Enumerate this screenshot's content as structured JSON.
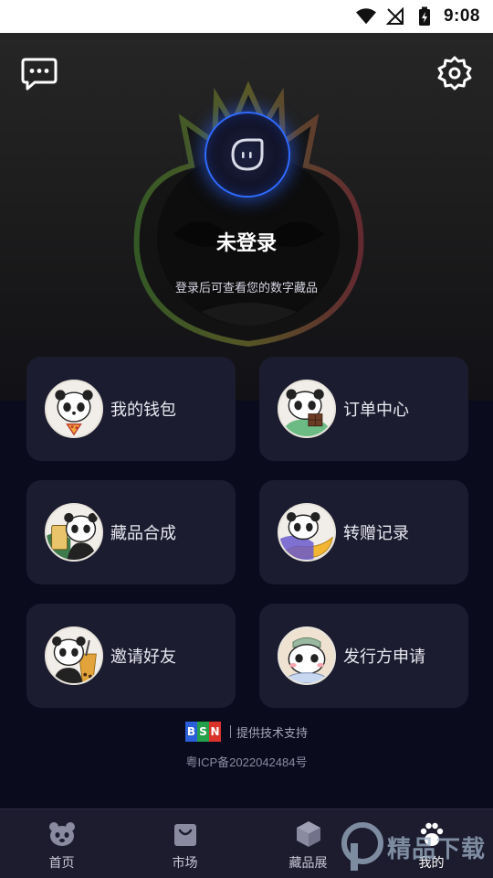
{
  "status_bar": {
    "time": "9:08"
  },
  "header": {
    "title": "未登录",
    "subtitle": "登录后可查看您的数字藏品",
    "icons": [
      "message-icon",
      "settings-icon",
      "avatar-icon"
    ]
  },
  "cards": [
    {
      "label": "我的钱包",
      "icon": "panda-pizza-avatar"
    },
    {
      "label": "订单中心",
      "icon": "panda-chocolate-avatar"
    },
    {
      "label": "藏品合成",
      "icon": "panda-drink-avatar"
    },
    {
      "label": "转赠记录",
      "icon": "panda-banana-avatar"
    },
    {
      "label": "邀请好友",
      "icon": "panda-bubbletea-avatar"
    },
    {
      "label": "发行方申请",
      "icon": "panda-cap-avatar"
    }
  ],
  "footer": {
    "bsn_letters": [
      "B",
      "S",
      "N"
    ],
    "support_text": "提供技术支持",
    "icp": "粤ICP备2022042484号"
  },
  "bottom_nav": [
    {
      "label": "首页",
      "icon": "bear-face-icon",
      "active": false
    },
    {
      "label": "市场",
      "icon": "shopping-bag-icon",
      "active": false
    },
    {
      "label": "藏品展",
      "icon": "cube-icon",
      "active": false
    },
    {
      "label": "我的",
      "icon": "paw-icon",
      "active": true
    }
  ],
  "watermark": {
    "text": "精品下载"
  },
  "colors": {
    "accent_blue": "#2f6bff",
    "card_bg": "#1c1c30",
    "page_bg": "#0b0b1e"
  }
}
